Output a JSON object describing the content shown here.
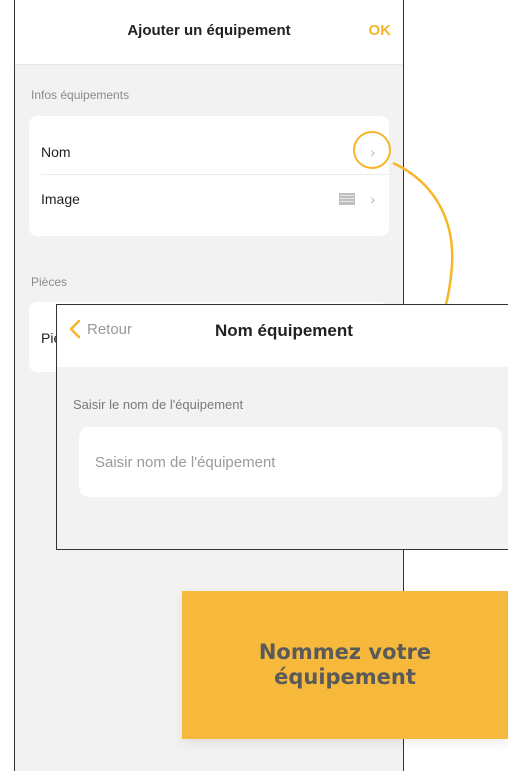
{
  "back_screen": {
    "title": "Ajouter un équipement",
    "ok_label": "OK",
    "section_info": "Infos équipements",
    "rows": [
      {
        "label": "Nom",
        "icon": "chevron-right-icon"
      },
      {
        "label": "Image",
        "icon": "chevron-right-icon"
      }
    ],
    "section_rooms": "Pièces",
    "rooms_row_partial": "Piè"
  },
  "front_screen": {
    "back_label": "Retour",
    "title": "Nom équipement",
    "field_label": "Saisir le nom de l'équipement",
    "input_placeholder": "Saisir nom de l'équipement",
    "input_value": ""
  },
  "caption": {
    "line1": "Nommez votre",
    "line2": "équipement"
  },
  "colors": {
    "accent": "#f6b628",
    "background": "#f2f2f2",
    "caption_bg": "#f6b93b"
  }
}
